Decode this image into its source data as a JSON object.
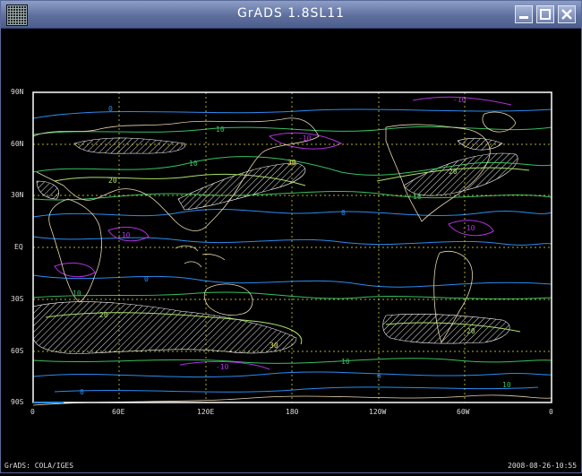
{
  "window": {
    "title": "GrADS 1.8SL11",
    "buttons": {
      "minimize": "minimize-icon",
      "maximize": "maximize-icon",
      "close": "close-icon"
    }
  },
  "plot": {
    "lat_labels": [
      "90N",
      "60N",
      "30N",
      "EQ",
      "30S",
      "60S",
      "90S"
    ],
    "lon_labels": [
      "0",
      "60E",
      "120E",
      "180",
      "120W",
      "60W",
      "0"
    ],
    "footer_left": "GrADS: COLA/IGES",
    "footer_right": "2008-08-26-10:55",
    "contour_labels": [
      "-10",
      "0",
      "10",
      "20",
      "30"
    ],
    "colors": {
      "neg": "#b030e0",
      "zero": "#2a8cf0",
      "pos10": "#38c060",
      "pos20": "#a8e068",
      "pos30": "#e8e860",
      "coast": "#e8d8b0",
      "hatch": "#ffffff",
      "grid": "#e8e840",
      "frame": "#ffffff"
    }
  }
}
